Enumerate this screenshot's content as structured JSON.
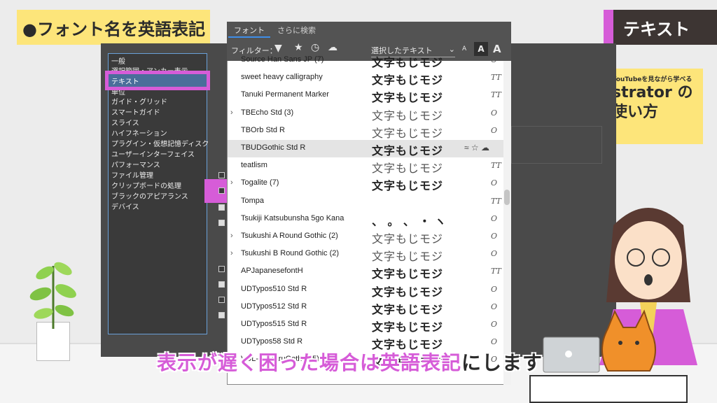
{
  "title_tag": "●フォント名を英語表記",
  "right_tag": "テキスト",
  "promo": {
    "small": "YouTubeを見ながら学べる",
    "line1": "strator の",
    "line2": "使い方"
  },
  "prefs": {
    "items": [
      "一般",
      "選択範囲・アンカー表示",
      "テキスト",
      "単位",
      "ガイド・グリッド",
      "スマートガイド",
      "スライス",
      "ハイフネーション",
      "プラグイン・仮想記憶ディスク",
      "ユーザーインターフェイス",
      "パフォーマンス",
      "ファイル管理",
      "クリップボードの処理",
      "ブラックのアピアランス",
      "デバイス"
    ],
    "selected": "テキスト"
  },
  "panel": {
    "tabs": [
      "フォント",
      "さらに検索"
    ],
    "filter_label": "フィルター：",
    "selected_text_label": "選択したテキスト",
    "size_labels": [
      "A",
      "A",
      "A"
    ]
  },
  "fonts": [
    {
      "name": "Source Han Sans JP (7)",
      "sample": "文字もじモジ",
      "type": "O",
      "chev": true
    },
    {
      "name": "sweet heavy calligraphy",
      "sample": "文字もじモジ",
      "type": "TT",
      "chev": false
    },
    {
      "name": "Tanuki Permanent Marker",
      "sample": "文字もじモジ",
      "type": "TT",
      "chev": false
    },
    {
      "name": "TBEcho Std (3)",
      "sample": "文字もじモジ",
      "type": "O",
      "chev": true
    },
    {
      "name": "TBOrb Std R",
      "sample": "文字もじモジ",
      "type": "O",
      "chev": false
    },
    {
      "name": "TBUDGothic Std R",
      "sample": "文字もじモジ",
      "type": "",
      "chev": false,
      "selected": true
    },
    {
      "name": "teatlism",
      "sample": "文字もじモジ",
      "type": "TT",
      "chev": false
    },
    {
      "name": "Togalite (7)",
      "sample": "文字もじモジ",
      "type": "O",
      "chev": true
    },
    {
      "name": "Tompa",
      "sample": "",
      "type": "TT",
      "chev": false
    },
    {
      "name": "Tsukiji Katsubunsha 5go Kana",
      "sample": "、 。 、 ・ ヽ",
      "type": "O",
      "chev": false
    },
    {
      "name": "Tsukushi A Round Gothic (2)",
      "sample": "文字もじモジ",
      "type": "O",
      "chev": true
    },
    {
      "name": "Tsukushi B Round Gothic (2)",
      "sample": "文字もじモジ",
      "type": "O",
      "chev": true
    },
    {
      "name": "APJapanesefontH",
      "sample": "文字もじモジ",
      "type": "TT",
      "chev": false
    },
    {
      "name": "UDTypos510 Std R",
      "sample": "文字もじモジ",
      "type": "O",
      "chev": false
    },
    {
      "name": "UDTypos512 Std R",
      "sample": "文字もじモジ",
      "type": "O",
      "chev": false
    },
    {
      "name": "UDTypos515 Std R",
      "sample": "文字もじモジ",
      "type": "O",
      "chev": false
    },
    {
      "name": "UDTypos58 Std R",
      "sample": "文字もじモジ",
      "type": "O",
      "chev": false
    },
    {
      "name": "VDL-V7MaruGothic (5)",
      "sample": "文字もじモジ",
      "type": "O",
      "chev": true
    }
  ],
  "selected_actions": "≈ ☆ ☁",
  "subtitle": {
    "pink": "表示が遅く困った場合は英語表記",
    "black": "にします"
  }
}
